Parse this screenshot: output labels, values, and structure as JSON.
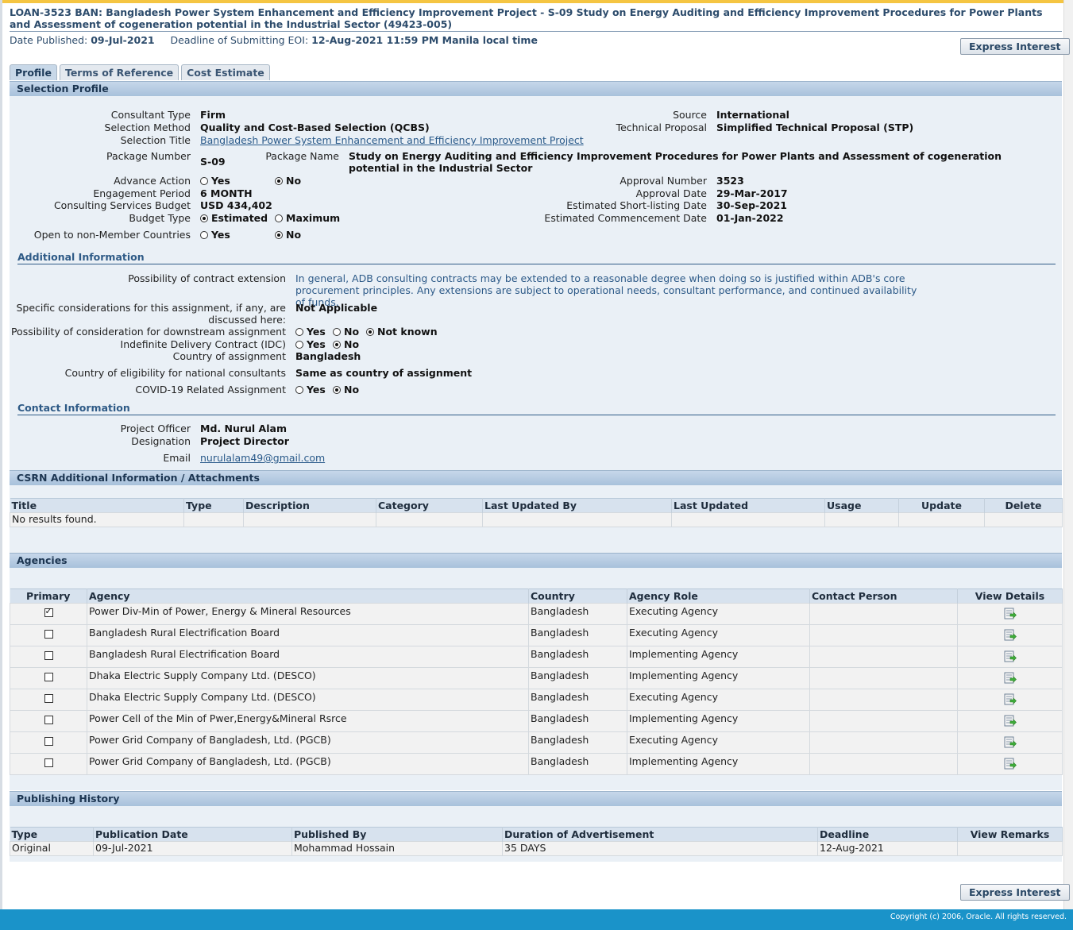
{
  "header": {
    "title": "LOAN-3523 BAN: Bangladesh Power System Enhancement and Efficiency Improvement Project - S-09 Study on Energy Auditing and Efficiency Improvement Procedures for Power Plants and Assessment of cogeneration potential in the Industrial Sector (49423-005)",
    "date_published_label": "Date Published:",
    "date_published": "09-Jul-2021",
    "deadline_label": "Deadline of Submitting EOI:",
    "deadline": "12-Aug-2021 11:59 PM Manila local time",
    "express_interest": "Express Interest"
  },
  "tabs": [
    "Profile",
    "Terms of Reference",
    "Cost Estimate"
  ],
  "selection_profile": {
    "heading": "Selection Profile",
    "consultant_type_label": "Consultant Type",
    "consultant_type": "Firm",
    "selection_method_label": "Selection Method",
    "selection_method": "Quality and Cost-Based Selection (QCBS)",
    "selection_title_label": "Selection Title",
    "selection_title": "Bangladesh Power System Enhancement and Efficiency Improvement Project",
    "package_number_label": "Package Number",
    "package_number": "S-09",
    "package_name_label": "Package Name",
    "package_name": "Study on Energy Auditing and Efficiency Improvement Procedures for Power Plants and Assessment of cogeneration potential in the Industrial Sector",
    "advance_action_label": "Advance Action",
    "engagement_period_label": "Engagement Period",
    "engagement_period": "6 MONTH",
    "consulting_budget_label": "Consulting Services Budget",
    "consulting_budget": "USD 434,402",
    "budget_type_label": "Budget Type",
    "non_member_label": "Open to non-Member Countries",
    "source_label": "Source",
    "source": "International",
    "technical_proposal_label": "Technical Proposal",
    "technical_proposal": "Simplified Technical Proposal (STP)",
    "approval_number_label": "Approval Number",
    "approval_number": "3523",
    "approval_date_label": "Approval Date",
    "approval_date": "29-Mar-2017",
    "shortlisting_label": "Estimated Short-listing Date",
    "shortlisting": "30-Sep-2021",
    "commencement_label": "Estimated Commencement Date",
    "commencement": "01-Jan-2022",
    "opt_yes": "Yes",
    "opt_no": "No",
    "opt_estimated": "Estimated",
    "opt_maximum": "Maximum",
    "opt_not_known": "Not known"
  },
  "additional": {
    "heading": "Additional Information",
    "extension_label": "Possibility of contract extension",
    "extension": "In general, ADB consulting contracts may be extended to a reasonable degree when doing so is justified within ADB's core procurement principles. Any extensions are subject to operational needs, consultant performance, and continued availability of funds.",
    "specific_label_1": "Specific considerations for this assignment, if any, are",
    "specific_label_2": "discussed here:",
    "specific": "Not Applicable",
    "downstream_label": "Possibility of consideration for downstream assignment",
    "idc_label": "Indefinite Delivery Contract (IDC)",
    "country_label": "Country of assignment",
    "country": "Bangladesh",
    "eligibility_label": "Country of eligibility for national consultants",
    "eligibility": "Same as country of assignment",
    "covid_label": "COVID-19 Related Assignment"
  },
  "contact": {
    "heading": "Contact Information",
    "officer_label": "Project Officer",
    "officer": "Md. Nurul Alam",
    "designation_label": "Designation",
    "designation": "Project Director",
    "email_label": "Email",
    "email": "nurulalam49@gmail.com"
  },
  "attachments": {
    "heading": "CSRN Additional Information / Attachments",
    "columns": [
      "Title",
      "Type",
      "Description",
      "Category",
      "Last Updated By",
      "Last Updated",
      "Usage",
      "Update",
      "Delete"
    ],
    "empty": "No results found."
  },
  "agencies": {
    "heading": "Agencies",
    "columns": [
      "Primary",
      "Agency",
      "Country",
      "Agency Role",
      "Contact Person",
      "View Details"
    ],
    "rows": [
      {
        "primary": true,
        "agency": "Power Div-Min of Power, Energy & Mineral Resources",
        "country": "Bangladesh",
        "role": "Executing Agency"
      },
      {
        "primary": false,
        "agency": "Bangladesh Rural Electrification Board",
        "country": "Bangladesh",
        "role": "Executing Agency"
      },
      {
        "primary": false,
        "agency": "Bangladesh Rural Electrification Board",
        "country": "Bangladesh",
        "role": "Implementing Agency"
      },
      {
        "primary": false,
        "agency": "Dhaka Electric Supply Company Ltd. (DESCO)",
        "country": "Bangladesh",
        "role": "Implementing Agency"
      },
      {
        "primary": false,
        "agency": "Dhaka Electric Supply Company Ltd. (DESCO)",
        "country": "Bangladesh",
        "role": "Executing Agency"
      },
      {
        "primary": false,
        "agency": "Power Cell of the Min of Pwer,Energy&Mineral Rsrce",
        "country": "Bangladesh",
        "role": "Implementing Agency"
      },
      {
        "primary": false,
        "agency": "Power Grid Company of Bangladesh, Ltd. (PGCB)",
        "country": "Bangladesh",
        "role": "Executing Agency"
      },
      {
        "primary": false,
        "agency": "Power Grid Company of Bangladesh, Ltd. (PGCB)",
        "country": "Bangladesh",
        "role": "Implementing Agency"
      }
    ]
  },
  "history": {
    "heading": "Publishing History",
    "columns": [
      "Type",
      "Publication Date",
      "Published By",
      "Duration of Advertisement",
      "Deadline",
      "View Remarks"
    ],
    "rows": [
      {
        "type": "Original",
        "date": "09-Jul-2021",
        "by": "Mohammad Hossain",
        "duration": "35 DAYS",
        "deadline": "12-Aug-2021"
      }
    ]
  },
  "footer": {
    "copyright": "Copyright (c) 2006, Oracle. All rights reserved."
  },
  "colors": {
    "accent": "#1a93c9",
    "section_bar": "#b7cde3",
    "panel": "#eaf0f6",
    "link": "#2a5a8a"
  }
}
